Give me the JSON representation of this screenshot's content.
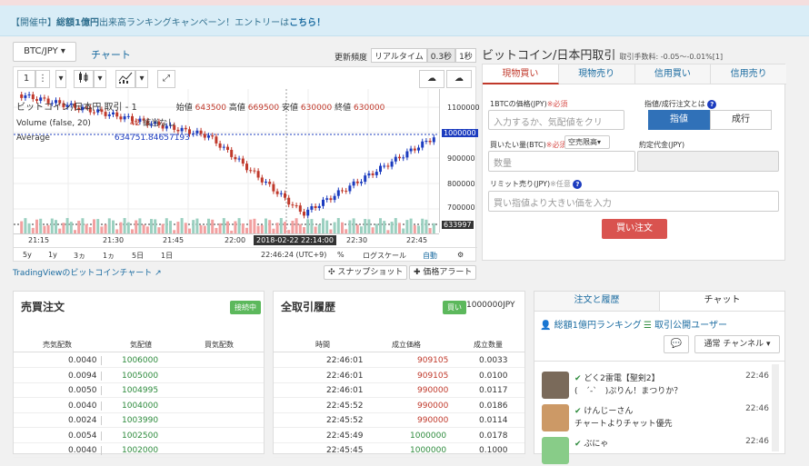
{
  "notice": {
    "prefix": "【開催中】",
    "bold": "総額1億円",
    "text": "出来高ランキングキャンペーン！エントリーは",
    "link": "こちら！"
  },
  "pair": {
    "value": "BTC/JPY ▾"
  },
  "chart_tab": "チャート",
  "speed": {
    "label": "更新頻度",
    "options": [
      "リアルタイム",
      "0.3秒",
      "1秒"
    ]
  },
  "chart_toolbar": {
    "interval": "1",
    "menu": "⋮"
  },
  "legend": {
    "title": "ビットコイン/日本円 取引 - 1",
    "open_label": "始値",
    "open": "643500",
    "high_label": "高値",
    "high": "669500",
    "low_label": "安値",
    "low": "630000",
    "close_label": "終値",
    "close": "630000",
    "volume": "Volume (false, 20)",
    "volume_val": "42",
    "volume_note": "該当なし",
    "average": "Average",
    "average_val": "634751.84657193"
  },
  "y_axis": [
    "1100000",
    "1000000",
    "900000",
    "800000",
    "700000",
    "633997"
  ],
  "x_axis": [
    "21:15",
    "21:30",
    "21:45",
    "22:00",
    "22:30",
    "22:45"
  ],
  "x_cursor": "2018-02-22 22:14:00",
  "chart_footer": {
    "ranges": [
      "5y",
      "1y",
      "3ヵ",
      "1ヵ",
      "5日",
      "1日"
    ],
    "clock": "22:46:24 (UTC+9)",
    "pct": "%",
    "log": "ログスケール",
    "auto": "自動"
  },
  "tv_link": "TradingViewのビットコインチャート",
  "snapshot": "スナップショット",
  "price_alert": "価格アラート",
  "trade": {
    "title": "ビットコイン/日本円取引",
    "fee": "取引手数料: -0.05〜-0.01%[1]",
    "tabs": [
      "現物買い",
      "現物売り",
      "信用買い",
      "信用売り"
    ],
    "price_label": "1BTCの価格(JPY)",
    "required": "※必須",
    "price_placeholder": "入力するか、気配値をクリ",
    "order_type_label": "指値/成行注文とは",
    "limit": "指値",
    "market": "成行",
    "qty_label": "買いたい量(BTC)",
    "qty_select": "空売限高▾",
    "qty_placeholder": "数量",
    "est_label": "約定代金(JPY)",
    "stop_label": "リミット売り(JPY)",
    "optional": "※任意",
    "stop_placeholder": "買い指値より大きい価を入力",
    "buy": "買い注文"
  },
  "orderbook": {
    "title": "売買注文",
    "status": "接続中",
    "headers": [
      "売気配数",
      "気配値",
      "買気配数"
    ],
    "rows": [
      {
        "qty": "0.0040",
        "price": "1006000"
      },
      {
        "qty": "0.0094",
        "price": "1005000"
      },
      {
        "qty": "0.0050",
        "price": "1004995"
      },
      {
        "qty": "0.0040",
        "price": "1004000"
      },
      {
        "qty": "0.0024",
        "price": "1003990"
      },
      {
        "qty": "0.0054",
        "price": "1002500"
      },
      {
        "qty": "0.0040",
        "price": "1002000"
      }
    ]
  },
  "history": {
    "title": "全取引履歴",
    "side": "買い",
    "amount": "1000000JPY",
    "headers": [
      "時間",
      "成立価格",
      "成立数量"
    ],
    "rows": [
      {
        "time": "22:46:01",
        "price": "909105",
        "qty": "0.0033",
        "color": "red"
      },
      {
        "time": "22:46:01",
        "price": "909105",
        "qty": "0.0100",
        "color": "red"
      },
      {
        "time": "22:46:01",
        "price": "990000",
        "qty": "0.0117",
        "color": "red"
      },
      {
        "time": "22:45:52",
        "price": "990000",
        "qty": "0.0186",
        "color": "red"
      },
      {
        "time": "22:45:52",
        "price": "990000",
        "qty": "0.0114",
        "color": "red"
      },
      {
        "time": "22:45:49",
        "price": "1000000",
        "qty": "0.0178",
        "color": "green"
      },
      {
        "time": "22:45:45",
        "price": "1000000",
        "qty": "0.1000",
        "color": "green"
      }
    ]
  },
  "chat": {
    "tabs": [
      "注文と履歴",
      "チャット"
    ],
    "ranking": "総額1億円ランキング",
    "public_users": "取引公開ユーザー",
    "channel": "通常 チャンネル ▾",
    "messages": [
      {
        "name": "どく2雷電【聖剣2】",
        "text": "(　´-`　)ぷりん！まつりか？",
        "time": "22:46"
      },
      {
        "name": "けんじーさん",
        "text": "チャートよりチャット優先",
        "time": "22:46"
      },
      {
        "name": "ぶにゃ",
        "text": "",
        "time": "22:46"
      }
    ]
  }
}
